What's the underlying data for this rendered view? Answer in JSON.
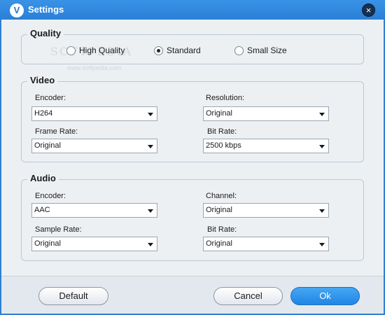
{
  "window": {
    "title": "Settings",
    "app_icon_letter": "V",
    "close_label": "×"
  },
  "watermark": {
    "logo": "SOFTPEDIA",
    "url": "www.softpedia.com"
  },
  "quality": {
    "legend": "Quality",
    "options": [
      {
        "label": "High Quality",
        "checked": false
      },
      {
        "label": "Standard",
        "checked": true
      },
      {
        "label": "Small Size",
        "checked": false
      }
    ]
  },
  "video": {
    "legend": "Video",
    "encoder": {
      "label": "Encoder:",
      "value": "H264"
    },
    "resolution": {
      "label": "Resolution:",
      "value": "Original"
    },
    "frame_rate": {
      "label": "Frame Rate:",
      "value": "Original"
    },
    "bit_rate": {
      "label": "Bit Rate:",
      "value": "2500 kbps"
    }
  },
  "audio": {
    "legend": "Audio",
    "encoder": {
      "label": "Encoder:",
      "value": "AAC"
    },
    "channel": {
      "label": "Channel:",
      "value": "Original"
    },
    "sample_rate": {
      "label": "Sample Rate:",
      "value": "Original"
    },
    "bit_rate": {
      "label": "Bit Rate:",
      "value": "Original"
    }
  },
  "buttons": {
    "default": "Default",
    "cancel": "Cancel",
    "ok": "Ok"
  }
}
